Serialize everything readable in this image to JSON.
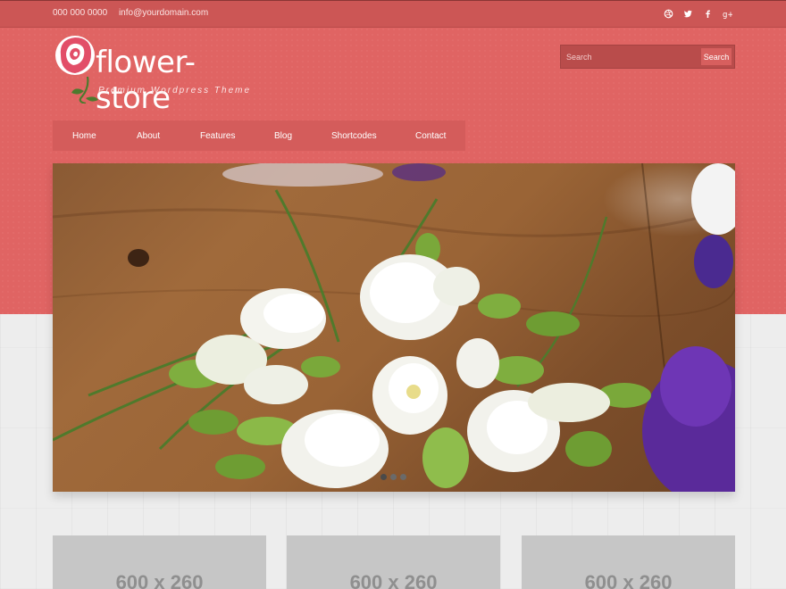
{
  "topbar": {
    "phone": "000 000 0000",
    "email": "info@yourdomain.com",
    "social_icons": [
      "dribbble-icon",
      "twitter-icon",
      "facebook-icon",
      "google-plus-icon"
    ]
  },
  "logo": {
    "title": "flower-store",
    "tagline": "Premium Wordpress Theme"
  },
  "search": {
    "placeholder": "Search",
    "button_label": "Search"
  },
  "nav": {
    "items": [
      "Home",
      "About",
      "Features",
      "Blog",
      "Shortcodes",
      "Contact"
    ]
  },
  "slider": {
    "slide_count": 3,
    "active_index": 0
  },
  "cards": [
    {
      "label": "600 x 260"
    },
    {
      "label": "600 x 260"
    },
    {
      "label": "600 x 260"
    }
  ],
  "colors": {
    "accent": "#e06463",
    "topbar": "#cc5655",
    "nav": "#d45c5b",
    "placeholder_card": "#c6c6c6"
  }
}
